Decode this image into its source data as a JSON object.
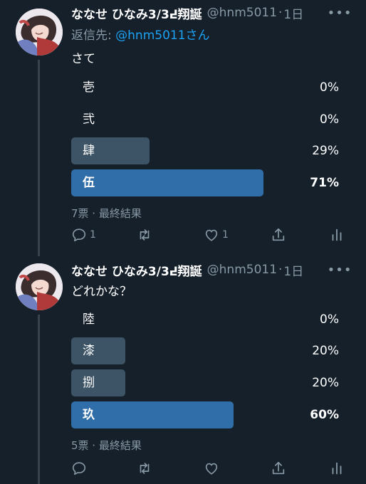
{
  "tweets": [
    {
      "author": {
        "name": "ななせ ひなみ߄3/3翔誕",
        "handle": "@hnm5011",
        "time": "1日"
      },
      "reply_to": {
        "prefix": "返信先: ",
        "mention": "@hnm5011さん"
      },
      "text": "さて",
      "poll": {
        "options": [
          {
            "label": "壱",
            "percent": "0%",
            "fraction": 0.0,
            "winner": false
          },
          {
            "label": "弐",
            "percent": "0%",
            "fraction": 0.0,
            "winner": false
          },
          {
            "label": "肆",
            "percent": "29%",
            "fraction": 0.29,
            "winner": false
          },
          {
            "label": "伍",
            "percent": "71%",
            "fraction": 0.71,
            "winner": true
          }
        ],
        "meta": "7票 · 最終結果"
      },
      "actions": {
        "reply_count": "1",
        "retweet_count": "",
        "like_count": "1"
      },
      "icons": [
        "reply-icon",
        "retweet-icon",
        "like-icon",
        "share-icon",
        "analytics-icon"
      ]
    },
    {
      "author": {
        "name": "ななせ ひなみ߄3/3翔誕",
        "handle": "@hnm5011",
        "time": "1日"
      },
      "text": "どれかな？",
      "poll": {
        "options": [
          {
            "label": "陸",
            "percent": "0%",
            "fraction": 0.0,
            "winner": false
          },
          {
            "label": "漆",
            "percent": "20%",
            "fraction": 0.2,
            "winner": false
          },
          {
            "label": "捌",
            "percent": "20%",
            "fraction": 0.2,
            "winner": false
          },
          {
            "label": "玖",
            "percent": "60%",
            "fraction": 0.6,
            "winner": true
          }
        ],
        "meta": "5票 · 最終結果"
      },
      "actions": {
        "reply_count": "",
        "retweet_count": "",
        "like_count": ""
      },
      "icons": [
        "reply-icon",
        "retweet-icon",
        "like-icon",
        "share-icon",
        "analytics-icon"
      ]
    }
  ],
  "colors": {
    "background": "#15202b",
    "secondary_text": "#8899a6",
    "link": "#1da1f2",
    "bar_winner": "#2f6ea8",
    "bar_other": "#3d5466"
  }
}
